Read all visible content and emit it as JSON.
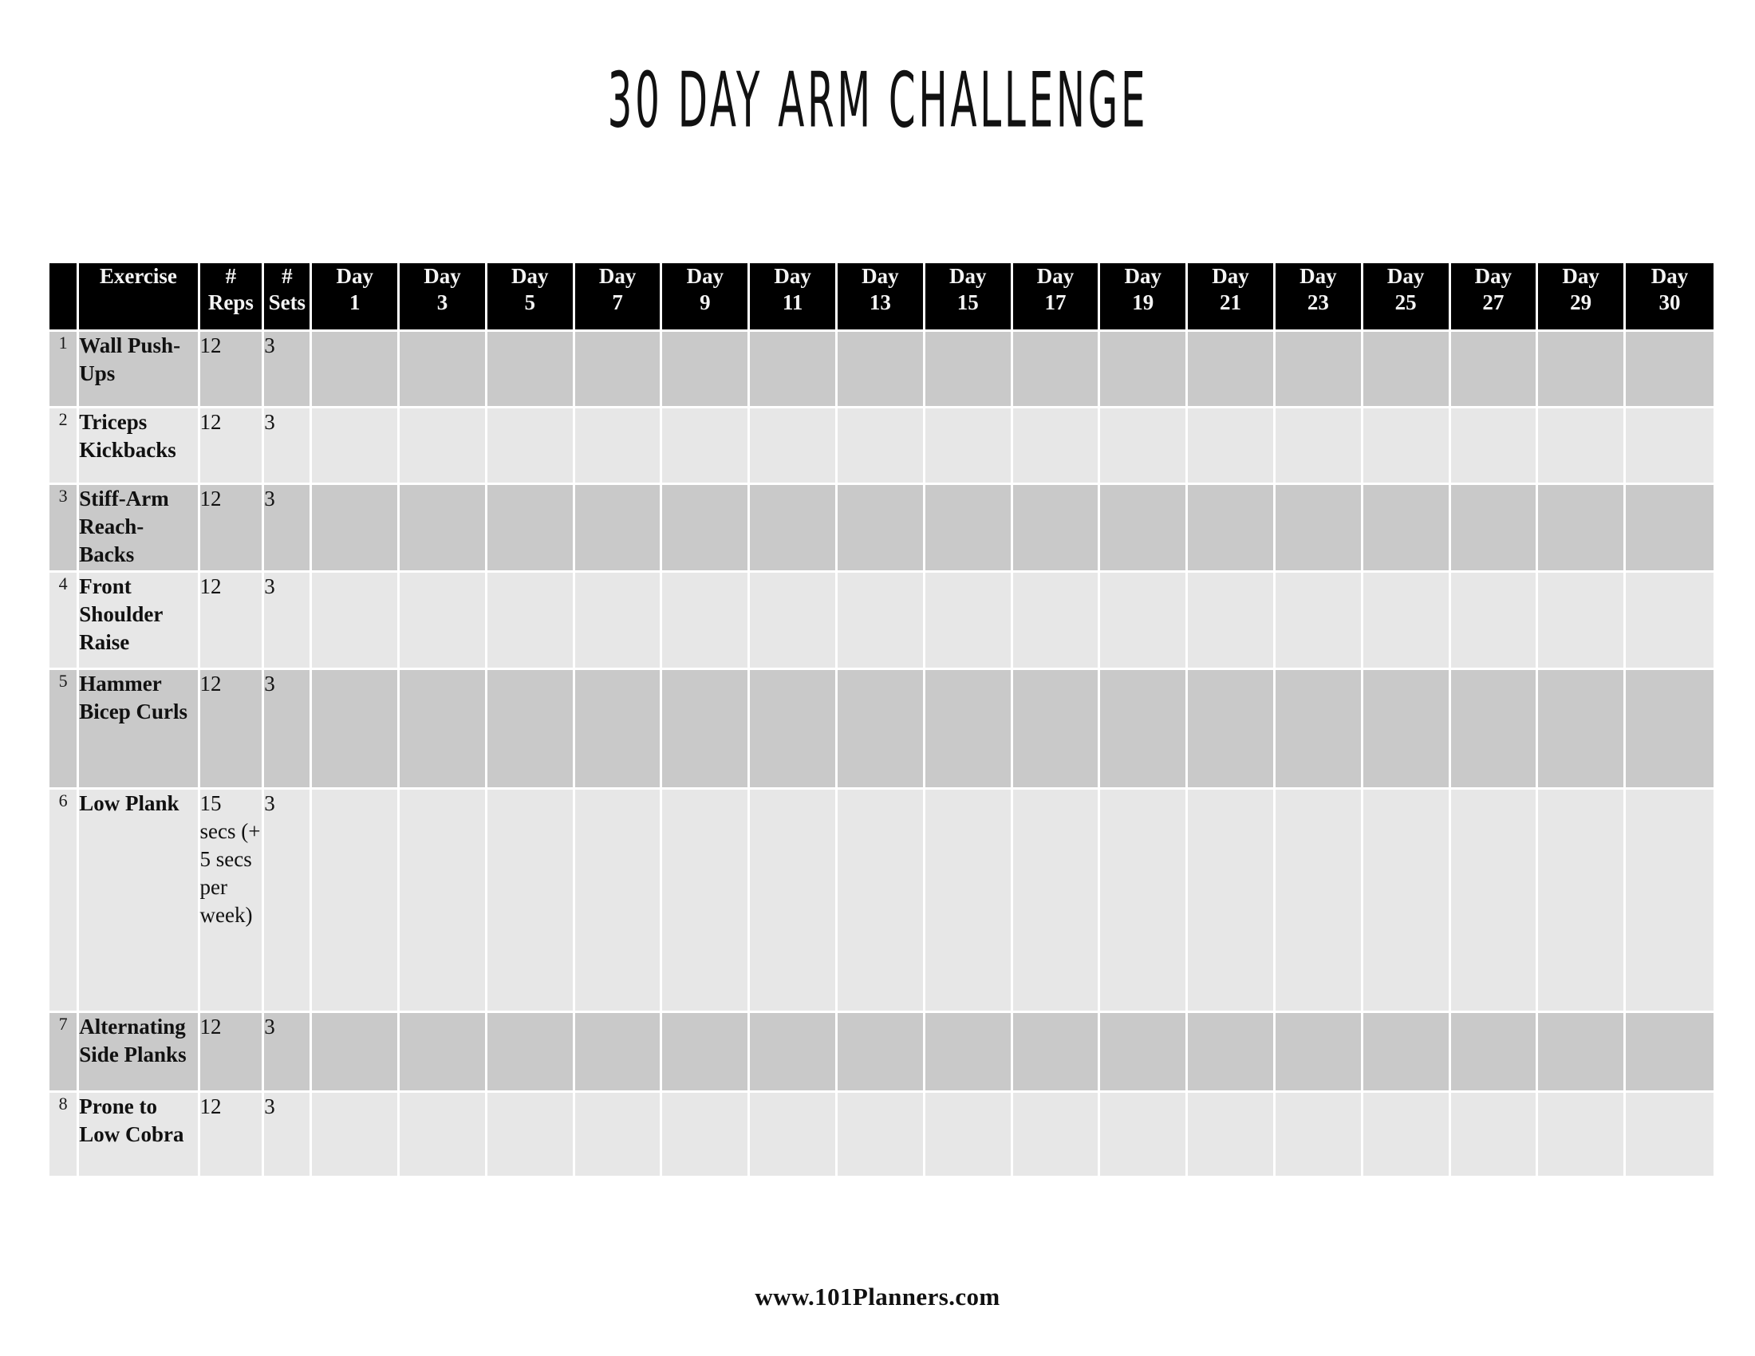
{
  "page": {
    "title": "30 DAY ARM CHALLENGE",
    "background_color": "#ffffff",
    "text_color": "#111111"
  },
  "table": {
    "header_background": "#000000",
    "header_text_color": "#f4f4f4",
    "row_band_dark": "#c9c9c9",
    "row_band_light": "#e7e7e7",
    "gridline_color": "#ffffff",
    "columns": {
      "index": "",
      "exercise": "Exercise",
      "reps_line1": "#",
      "reps_line2": "Reps",
      "sets_line1": "#",
      "sets_line2": "Sets",
      "day_label": "Day"
    },
    "day_columns": [
      {
        "label": "Day",
        "number": "1"
      },
      {
        "label": "Day",
        "number": "3"
      },
      {
        "label": "Day",
        "number": "5"
      },
      {
        "label": "Day",
        "number": "7"
      },
      {
        "label": "Day",
        "number": "9"
      },
      {
        "label": "Day",
        "number": "11"
      },
      {
        "label": "Day",
        "number": "13"
      },
      {
        "label": "Day",
        "number": "15"
      },
      {
        "label": "Day",
        "number": "17"
      },
      {
        "label": "Day",
        "number": "19"
      },
      {
        "label": "Day",
        "number": "21"
      },
      {
        "label": "Day",
        "number": "23"
      },
      {
        "label": "Day",
        "number": "25"
      },
      {
        "label": "Day",
        "number": "27"
      },
      {
        "label": "Day",
        "number": "29"
      },
      {
        "label": "Day",
        "number": "30"
      }
    ],
    "rows": [
      {
        "index": "1",
        "exercise": "Wall Push-Ups",
        "reps": "12",
        "sets": "3"
      },
      {
        "index": "2",
        "exercise": "Triceps Kickbacks",
        "reps": "12",
        "sets": "3"
      },
      {
        "index": "3",
        "exercise": "Stiff-Arm Reach-Backs",
        "reps": "12",
        "sets": "3"
      },
      {
        "index": "4",
        "exercise": "Front Shoulder Raise",
        "reps": "12",
        "sets": "3"
      },
      {
        "index": "5",
        "exercise": "Hammer Bicep Curls",
        "reps": "12",
        "sets": "3"
      },
      {
        "index": "6",
        "exercise": "Low Plank",
        "reps": "15 secs (+ 5 secs per week)",
        "sets": "3"
      },
      {
        "index": "7",
        "exercise": "Alternating Side Planks",
        "reps": "12",
        "sets": "3"
      },
      {
        "index": "8",
        "exercise": "Prone to Low Cobra",
        "reps": "12",
        "sets": "3"
      }
    ]
  },
  "footer": {
    "website": "www.101Planners.com"
  }
}
